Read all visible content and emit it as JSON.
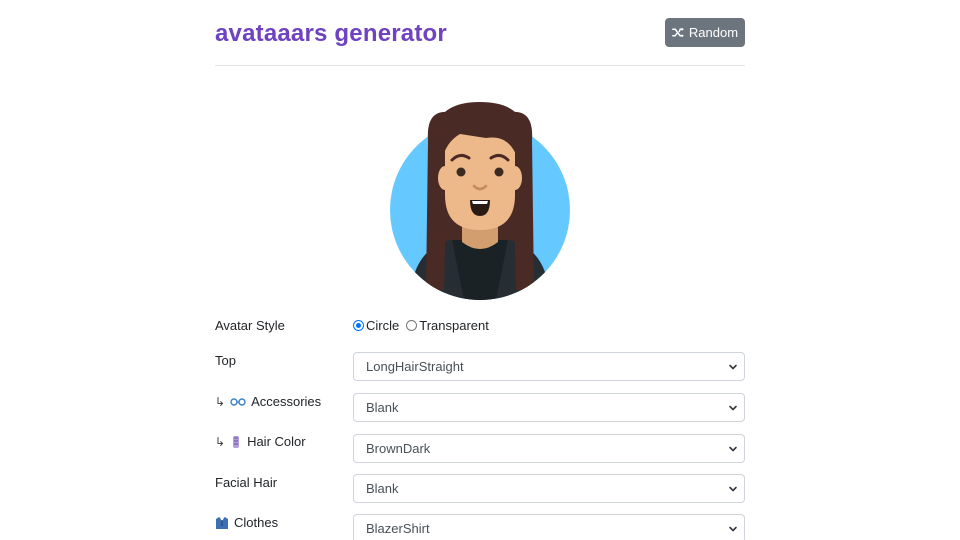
{
  "header": {
    "title": "avataaars generator",
    "random_label": "Random",
    "random_icon": "shuffle-icon"
  },
  "avatar": {
    "background_color": "#65c9ff",
    "hair_color": "#4a2a24",
    "skin_color": "#edb98a",
    "clothes_color": "#262e33"
  },
  "form": {
    "avatar_style": {
      "label": "Avatar Style",
      "options": [
        "Circle",
        "Transparent"
      ],
      "selected": "Circle"
    },
    "top": {
      "label": "Top",
      "value": "LongHairStraight"
    },
    "accessories": {
      "prefix": "↳",
      "icon": "glasses-icon",
      "label": "Accessories",
      "value": "Blank"
    },
    "hair_color": {
      "prefix": "↳",
      "icon": "hair-icon",
      "label": "Hair Color",
      "value": "BrownDark"
    },
    "facial_hair": {
      "label": "Facial Hair",
      "value": "Blank"
    },
    "clothes": {
      "icon": "shirt-icon",
      "label": "Clothes",
      "value": "BlazerShirt"
    }
  },
  "colors": {
    "title": "#6f42c1",
    "button_bg": "#6c757d",
    "radio_accent": "#0075ff"
  }
}
